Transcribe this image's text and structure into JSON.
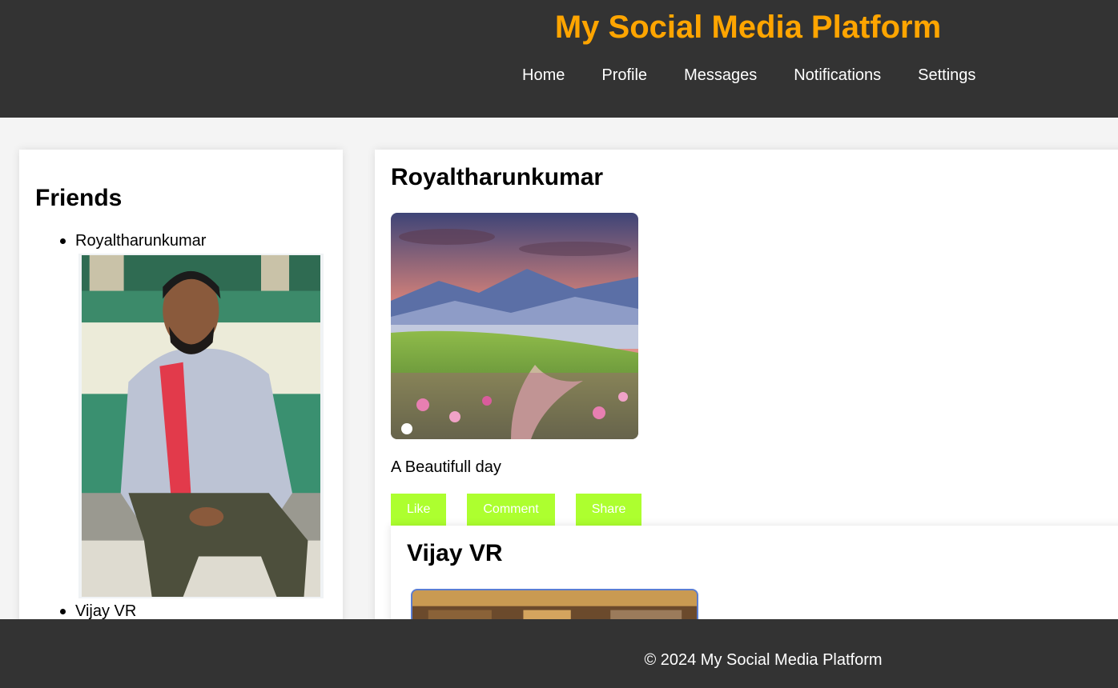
{
  "header": {
    "title": "My Social Media Platform",
    "nav": [
      "Home",
      "Profile",
      "Messages",
      "Notifications",
      "Settings"
    ]
  },
  "friends": {
    "heading": "Friends",
    "items": [
      {
        "name": "Royaltharunkumar"
      },
      {
        "name": "Vijay VR"
      }
    ]
  },
  "posts": [
    {
      "author": "Royaltharunkumar",
      "text": "A Beautifull day",
      "actions": [
        "Like",
        "Comment",
        "Share"
      ]
    },
    {
      "author": "Vijay VR"
    }
  ],
  "footer": {
    "copyright": "© 2024 My Social Media Platform"
  },
  "colors": {
    "header_bg": "#333333",
    "title": "#ffa500",
    "action_button": "#adff2f",
    "page_bg": "#f4f4f4"
  }
}
